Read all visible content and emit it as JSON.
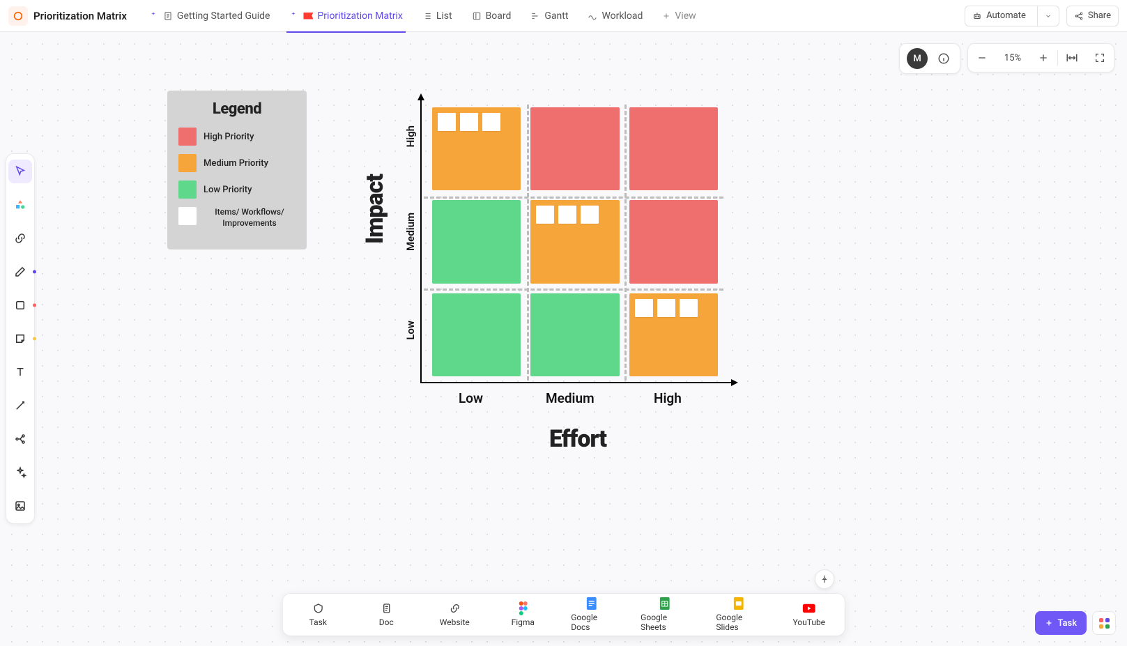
{
  "header": {
    "space_title": "Prioritization Matrix",
    "views": [
      {
        "icon": "doc-ai",
        "label": "Getting Started Guide",
        "active": false
      },
      {
        "icon": "whiteboard",
        "label": "Prioritization Matrix",
        "active": true,
        "flag": true
      },
      {
        "icon": "list",
        "label": "List",
        "active": false
      },
      {
        "icon": "board",
        "label": "Board",
        "active": false
      },
      {
        "icon": "gantt",
        "label": "Gantt",
        "active": false
      },
      {
        "icon": "workload",
        "label": "Workload",
        "active": false
      }
    ],
    "add_view": "View",
    "automate": "Automate",
    "share": "Share"
  },
  "floating": {
    "avatar_letter": "M",
    "zoom_label": "15%"
  },
  "legend": {
    "title": "Legend",
    "items": [
      {
        "color": "#ef6e6e",
        "label": "High Priority"
      },
      {
        "color": "#f5a539",
        "label": "Medium Priority"
      },
      {
        "color": "#5fd88b",
        "label": "Low Priority"
      },
      {
        "color": "#ffffff",
        "label": "Items/ Workflows/ Improvements",
        "note": true
      }
    ]
  },
  "matrix": {
    "y_title": "Impact",
    "x_title": "Effort",
    "y_levels": [
      "High",
      "Medium",
      "Low"
    ],
    "x_levels": [
      "Low",
      "Medium",
      "High"
    ],
    "cells": [
      {
        "row": 0,
        "col": 0,
        "priority": "orange",
        "notes": 3
      },
      {
        "row": 0,
        "col": 1,
        "priority": "red",
        "notes": 0
      },
      {
        "row": 0,
        "col": 2,
        "priority": "red",
        "notes": 0
      },
      {
        "row": 1,
        "col": 0,
        "priority": "green",
        "notes": 0
      },
      {
        "row": 1,
        "col": 1,
        "priority": "orange",
        "notes": 3
      },
      {
        "row": 1,
        "col": 2,
        "priority": "red",
        "notes": 0
      },
      {
        "row": 2,
        "col": 0,
        "priority": "green",
        "notes": 0
      },
      {
        "row": 2,
        "col": 1,
        "priority": "green",
        "notes": 0
      },
      {
        "row": 2,
        "col": 2,
        "priority": "orange",
        "notes": 3
      }
    ]
  },
  "bottom_bar": {
    "items": [
      {
        "label": "Task",
        "icon": "task"
      },
      {
        "label": "Doc",
        "icon": "doc"
      },
      {
        "label": "Website",
        "icon": "link"
      },
      {
        "label": "Figma",
        "icon": "figma"
      },
      {
        "label": "Google Docs",
        "icon": "gdoc"
      },
      {
        "label": "Google Sheets",
        "icon": "gsheet"
      },
      {
        "label": "Google Slides",
        "icon": "gslide"
      },
      {
        "label": "YouTube",
        "icon": "youtube"
      }
    ]
  },
  "task_fab": {
    "label": "Task"
  },
  "colors": {
    "high": "#ef6e6e",
    "medium": "#f5a539",
    "low": "#5fd88b",
    "accent": "#6f58f6"
  }
}
